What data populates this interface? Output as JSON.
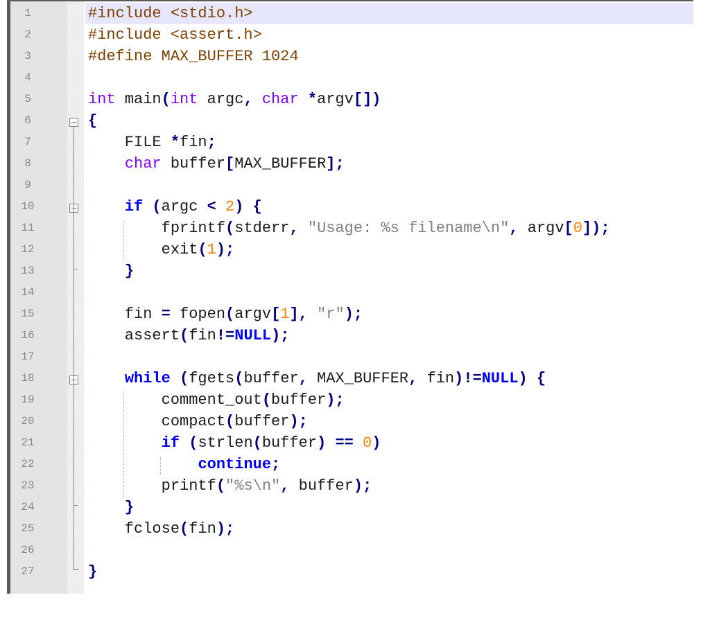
{
  "editor": {
    "current_line": 1,
    "colors": {
      "preprocessor": "#804000",
      "type_keyword": "#8000ff",
      "instruction_keyword": "#0000ff",
      "operator": "#000080",
      "number": "#ff8000",
      "string": "#808080",
      "current_line_bg": "#e6e6fd",
      "gutter_bg": "#e4e4e4"
    },
    "lines": [
      {
        "n": "1",
        "tokens": [
          [
            "pp",
            "#include <stdio.h>"
          ]
        ]
      },
      {
        "n": "2",
        "tokens": [
          [
            "pp",
            "#include <assert.h>"
          ]
        ]
      },
      {
        "n": "3",
        "tokens": [
          [
            "pp",
            "#define MAX_BUFFER 1024"
          ]
        ]
      },
      {
        "n": "4",
        "tokens": []
      },
      {
        "n": "5",
        "tokens": [
          [
            "kw",
            "int"
          ],
          [
            "id",
            " main"
          ],
          [
            "op",
            "("
          ],
          [
            "kw",
            "int"
          ],
          [
            "id",
            " argc"
          ],
          [
            "op",
            ","
          ],
          [
            "id",
            " "
          ],
          [
            "kw",
            "char"
          ],
          [
            "id",
            " "
          ],
          [
            "op",
            "*"
          ],
          [
            "id",
            "argv"
          ],
          [
            "op",
            "[])"
          ]
        ]
      },
      {
        "n": "6",
        "tokens": [
          [
            "op",
            "{"
          ]
        ]
      },
      {
        "n": "7",
        "tokens": [
          [
            "id",
            "    FILE "
          ],
          [
            "op",
            "*"
          ],
          [
            "id",
            "fin"
          ],
          [
            "op",
            ";"
          ]
        ]
      },
      {
        "n": "8",
        "tokens": [
          [
            "id",
            "    "
          ],
          [
            "kw",
            "char"
          ],
          [
            "id",
            " buffer"
          ],
          [
            "op",
            "["
          ],
          [
            "id",
            "MAX_BUFFER"
          ],
          [
            "op",
            "];"
          ]
        ]
      },
      {
        "n": "9",
        "tokens": []
      },
      {
        "n": "10",
        "tokens": [
          [
            "id",
            "    "
          ],
          [
            "kb",
            "if"
          ],
          [
            "id",
            " "
          ],
          [
            "op",
            "("
          ],
          [
            "id",
            "argc "
          ],
          [
            "op",
            "<"
          ],
          [
            "id",
            " "
          ],
          [
            "num",
            "2"
          ],
          [
            "op",
            ")"
          ],
          [
            "id",
            " "
          ],
          [
            "op",
            "{"
          ]
        ]
      },
      {
        "n": "11",
        "tokens": [
          [
            "id",
            "        fprintf"
          ],
          [
            "op",
            "("
          ],
          [
            "id",
            "stderr"
          ],
          [
            "op",
            ","
          ],
          [
            "id",
            " "
          ],
          [
            "str",
            "\"Usage: %s filename\\n\""
          ],
          [
            "op",
            ","
          ],
          [
            "id",
            " argv"
          ],
          [
            "op",
            "["
          ],
          [
            "num",
            "0"
          ],
          [
            "op",
            "]);"
          ]
        ]
      },
      {
        "n": "12",
        "tokens": [
          [
            "id",
            "        exit"
          ],
          [
            "op",
            "("
          ],
          [
            "num",
            "1"
          ],
          [
            "op",
            ");"
          ]
        ]
      },
      {
        "n": "13",
        "tokens": [
          [
            "id",
            "    "
          ],
          [
            "op",
            "}"
          ]
        ]
      },
      {
        "n": "14",
        "tokens": []
      },
      {
        "n": "15",
        "tokens": [
          [
            "id",
            "    fin "
          ],
          [
            "op",
            "="
          ],
          [
            "id",
            " fopen"
          ],
          [
            "op",
            "("
          ],
          [
            "id",
            "argv"
          ],
          [
            "op",
            "["
          ],
          [
            "num",
            "1"
          ],
          [
            "op",
            "],"
          ],
          [
            "id",
            " "
          ],
          [
            "str",
            "\"r\""
          ],
          [
            "op",
            ");"
          ]
        ]
      },
      {
        "n": "16",
        "tokens": [
          [
            "id",
            "    assert"
          ],
          [
            "op",
            "("
          ],
          [
            "id",
            "fin"
          ],
          [
            "op",
            "!="
          ],
          [
            "kb",
            "NULL"
          ],
          [
            "op",
            ");"
          ]
        ]
      },
      {
        "n": "17",
        "tokens": []
      },
      {
        "n": "18",
        "tokens": [
          [
            "id",
            "    "
          ],
          [
            "kb",
            "while"
          ],
          [
            "id",
            " "
          ],
          [
            "op",
            "("
          ],
          [
            "id",
            "fgets"
          ],
          [
            "op",
            "("
          ],
          [
            "id",
            "buffer"
          ],
          [
            "op",
            ","
          ],
          [
            "id",
            " MAX_BUFFER"
          ],
          [
            "op",
            ","
          ],
          [
            "id",
            " fin"
          ],
          [
            "op",
            ")!="
          ],
          [
            "kb",
            "NULL"
          ],
          [
            "op",
            ")"
          ],
          [
            "id",
            " "
          ],
          [
            "op",
            "{"
          ]
        ]
      },
      {
        "n": "19",
        "tokens": [
          [
            "id",
            "        comment_out"
          ],
          [
            "op",
            "("
          ],
          [
            "id",
            "buffer"
          ],
          [
            "op",
            ");"
          ]
        ]
      },
      {
        "n": "20",
        "tokens": [
          [
            "id",
            "        compact"
          ],
          [
            "op",
            "("
          ],
          [
            "id",
            "buffer"
          ],
          [
            "op",
            ");"
          ]
        ]
      },
      {
        "n": "21",
        "tokens": [
          [
            "id",
            "        "
          ],
          [
            "kb",
            "if"
          ],
          [
            "id",
            " "
          ],
          [
            "op",
            "("
          ],
          [
            "id",
            "strlen"
          ],
          [
            "op",
            "("
          ],
          [
            "id",
            "buffer"
          ],
          [
            "op",
            ")"
          ],
          [
            "id",
            " "
          ],
          [
            "op",
            "=="
          ],
          [
            "id",
            " "
          ],
          [
            "num",
            "0"
          ],
          [
            "op",
            ")"
          ]
        ]
      },
      {
        "n": "22",
        "tokens": [
          [
            "id",
            "            "
          ],
          [
            "kb",
            "continue"
          ],
          [
            "op",
            ";"
          ]
        ]
      },
      {
        "n": "23",
        "tokens": [
          [
            "id",
            "        printf"
          ],
          [
            "op",
            "("
          ],
          [
            "str",
            "\"%s\\n\""
          ],
          [
            "op",
            ","
          ],
          [
            "id",
            " buffer"
          ],
          [
            "op",
            ");"
          ]
        ]
      },
      {
        "n": "24",
        "tokens": [
          [
            "id",
            "    "
          ],
          [
            "op",
            "}"
          ]
        ]
      },
      {
        "n": "25",
        "tokens": [
          [
            "id",
            "    fclose"
          ],
          [
            "op",
            "("
          ],
          [
            "id",
            "fin"
          ],
          [
            "op",
            ");"
          ]
        ]
      },
      {
        "n": "26",
        "tokens": []
      },
      {
        "n": "27",
        "tokens": [
          [
            "op",
            "}"
          ]
        ]
      }
    ],
    "folds": [
      {
        "start": 6,
        "end": 27
      },
      {
        "start": 10,
        "end": 13
      },
      {
        "start": 18,
        "end": 24
      }
    ],
    "indent_guides": [
      {
        "from": 11,
        "to": 12,
        "level": 1
      },
      {
        "from": 19,
        "to": 23,
        "level": 1
      },
      {
        "from": 22,
        "to": 22,
        "level": 2
      }
    ]
  }
}
